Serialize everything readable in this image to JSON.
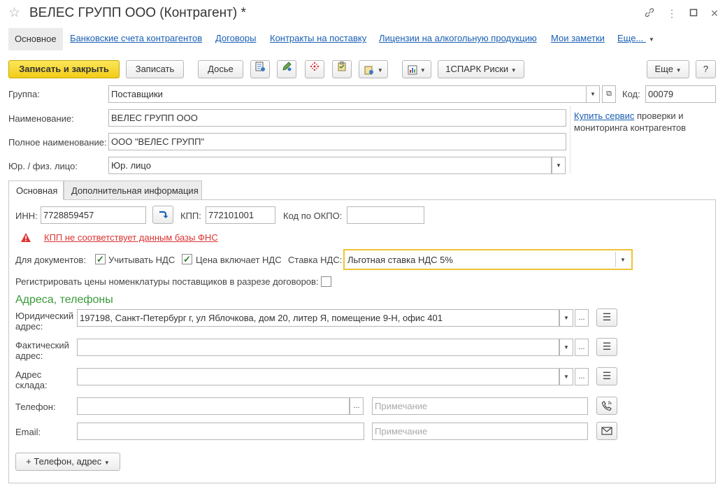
{
  "window": {
    "title": "ВЕЛЕС ГРУПП ООО (Контрагент) *",
    "star": "☆",
    "link_icon": "🔗",
    "menu_icon": "⋮",
    "maximize_icon": "□",
    "close_icon": "✕"
  },
  "nav": {
    "tabs": [
      "Основное",
      "Банковские счета контрагентов",
      "Договоры",
      "Контракты на поставку",
      "Лицензии на алкогольную продукцию",
      "Мои заметки",
      "Еще..."
    ]
  },
  "toolbar": {
    "save_close": "Записать и закрыть",
    "save": "Записать",
    "dossier": "Досье",
    "spark": "1СПАРК Риски",
    "more": "Еще",
    "help": "?"
  },
  "header": {
    "group_label": "Группа:",
    "group_value": "Поставщики",
    "code_label": "Код:",
    "code_value": "00079",
    "name_label": "Наименование:",
    "name_value": "ВЕЛЕС ГРУПП ООО",
    "fullname_label": "Полное наименование:",
    "fullname_value": "ООО \"ВЕЛЕС ГРУПП\"",
    "type_label": "Юр. / физ. лицо:",
    "type_value": "Юр. лицо",
    "service_link": "Купить сервис",
    "service_text1": " проверки и",
    "service_text2": "мониторинга контрагентов"
  },
  "tabs": {
    "main": "Основная",
    "extra": "Дополнительная информация"
  },
  "main": {
    "inn_label": "ИНН:",
    "inn_value": "7728859457",
    "kpp_label": "КПП:",
    "kpp_value": "772101001",
    "okpo_label": "Код по ОКПО:",
    "okpo_value": "",
    "warning": "КПП не соответствует данным базы ФНС",
    "docs_label": "Для документов:",
    "vat_account": "Учитывать НДС",
    "price_incl_vat": "Цена включает НДС",
    "vat_rate_label": "Ставка НДС:",
    "vat_rate_value": "Льготная ставка НДС 5%",
    "register_prices": "Регистрировать цены номенклатуры поставщиков в разрезе договоров:",
    "section_title": "Адреса, телефоны",
    "legal_addr_label1": "Юридический",
    "legal_addr_label2": "адрес:",
    "legal_addr_value": "197198, Санкт-Петербург г, ул Яблочкова, дом 20, литер Я, помещение 9-Н, офис 401",
    "actual_addr_label1": "Фактический",
    "actual_addr_label2": "адрес:",
    "actual_addr_value": "",
    "warehouse_label1": "Адрес",
    "warehouse_label2": "склада:",
    "warehouse_value": "",
    "phone_label": "Телефон:",
    "phone_value": "",
    "phone_note_placeholder": "Примечание",
    "email_label": "Email:",
    "email_value": "",
    "email_note_placeholder": "Примечание",
    "add_contact": "+ Телефон, адрес"
  }
}
